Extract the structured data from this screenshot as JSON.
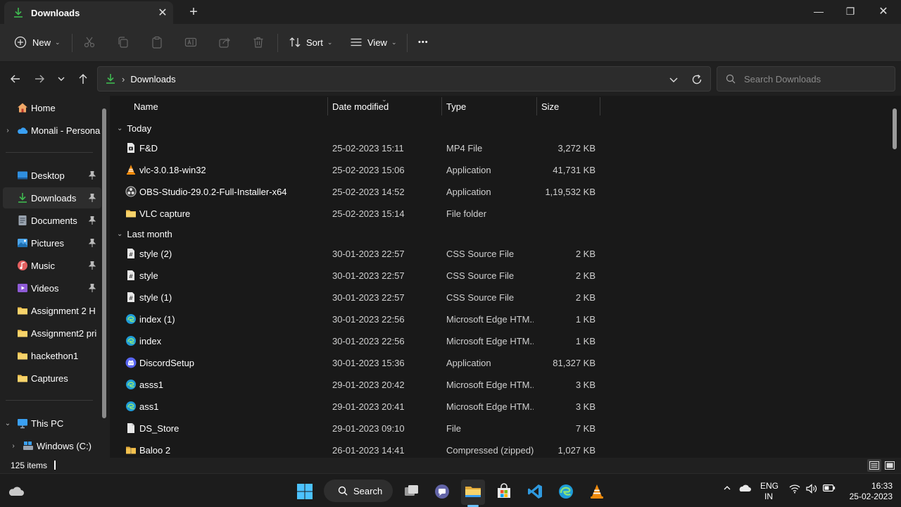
{
  "window": {
    "tab_title": "Downloads",
    "new_tab": "+",
    "close_tab": "✕",
    "minimize": "—",
    "maximize": "❐",
    "close": "✕"
  },
  "toolbar": {
    "new_label": "New",
    "sort_label": "Sort",
    "view_label": "View",
    "more_label": "•••"
  },
  "address": {
    "path": "Downloads",
    "search_placeholder": "Search Downloads"
  },
  "sidebar": {
    "items": [
      {
        "label": "Home",
        "icon": "home-icon",
        "pinned": false,
        "chevron": false
      },
      {
        "label": "Monali - Persona",
        "icon": "onedrive-cloud-icon",
        "pinned": false,
        "chevron": true
      },
      {
        "label": "Desktop",
        "icon": "desktop-icon",
        "pinned": true
      },
      {
        "label": "Downloads",
        "icon": "download-icon",
        "pinned": true,
        "selected": true
      },
      {
        "label": "Documents",
        "icon": "documents-icon",
        "pinned": true
      },
      {
        "label": "Pictures",
        "icon": "pictures-icon",
        "pinned": true
      },
      {
        "label": "Music",
        "icon": "music-icon",
        "pinned": true
      },
      {
        "label": "Videos",
        "icon": "videos-icon",
        "pinned": true
      },
      {
        "label": "Assignment 2 H",
        "icon": "folder-icon",
        "pinned": false
      },
      {
        "label": "Assignment2 pri",
        "icon": "folder-icon",
        "pinned": false
      },
      {
        "label": "hackethon1",
        "icon": "folder-icon",
        "pinned": false
      },
      {
        "label": "Captures",
        "icon": "folder-icon",
        "pinned": false
      },
      {
        "label": "This PC",
        "icon": "this-pc-icon",
        "chevron": true,
        "expanded": true
      },
      {
        "label": "Windows (C:)",
        "icon": "drive-icon",
        "chevron": true
      }
    ]
  },
  "columns": {
    "name": "Name",
    "date": "Date modified",
    "type": "Type",
    "size": "Size"
  },
  "groups": [
    {
      "label": "Today",
      "files": [
        {
          "name": "F&D",
          "date": "25-02-2023 15:11",
          "type": "MP4 File",
          "size": "3,272 KB",
          "icon": "video-file-icon"
        },
        {
          "name": "vlc-3.0.18-win32",
          "date": "25-02-2023 15:06",
          "type": "Application",
          "size": "41,731 KB",
          "icon": "vlc-icon"
        },
        {
          "name": "OBS-Studio-29.0.2-Full-Installer-x64",
          "date": "25-02-2023 14:52",
          "type": "Application",
          "size": "1,19,532 KB",
          "icon": "obs-icon"
        },
        {
          "name": "VLC capture",
          "date": "25-02-2023 15:14",
          "type": "File folder",
          "size": "",
          "icon": "folder-icon"
        }
      ]
    },
    {
      "label": "Last month",
      "files": [
        {
          "name": "style (2)",
          "date": "30-01-2023 22:57",
          "type": "CSS Source File",
          "size": "2 KB",
          "icon": "css-file-icon"
        },
        {
          "name": "style",
          "date": "30-01-2023 22:57",
          "type": "CSS Source File",
          "size": "2 KB",
          "icon": "css-file-icon"
        },
        {
          "name": "style (1)",
          "date": "30-01-2023 22:57",
          "type": "CSS Source File",
          "size": "2 KB",
          "icon": "css-file-icon"
        },
        {
          "name": "index (1)",
          "date": "30-01-2023 22:56",
          "type": "Microsoft Edge HTM...",
          "size": "1 KB",
          "icon": "edge-icon"
        },
        {
          "name": "index",
          "date": "30-01-2023 22:56",
          "type": "Microsoft Edge HTM...",
          "size": "1 KB",
          "icon": "edge-icon"
        },
        {
          "name": "DiscordSetup",
          "date": "30-01-2023 15:36",
          "type": "Application",
          "size": "81,327 KB",
          "icon": "discord-icon"
        },
        {
          "name": "asss1",
          "date": "29-01-2023 20:42",
          "type": "Microsoft Edge HTM...",
          "size": "3 KB",
          "icon": "edge-icon"
        },
        {
          "name": "ass1",
          "date": "29-01-2023 20:41",
          "type": "Microsoft Edge HTM...",
          "size": "3 KB",
          "icon": "edge-icon"
        },
        {
          "name": "DS_Store",
          "date": "29-01-2023 09:10",
          "type": "File",
          "size": "7 KB",
          "icon": "blank-file-icon"
        },
        {
          "name": "Baloo 2",
          "date": "26-01-2023 14:41",
          "type": "Compressed (zipped)...",
          "size": "1,027 KB",
          "icon": "zip-folder-icon"
        }
      ]
    }
  ],
  "status": {
    "item_count": "125 items"
  },
  "taskbar": {
    "search_label": "Search",
    "lang_top": "ENG",
    "lang_bottom": "IN",
    "time": "16:33",
    "date": "25-02-2023"
  },
  "colors": {
    "accent": "#60cdff",
    "download_green": "#3fb950",
    "folder": "#f2c14e"
  }
}
